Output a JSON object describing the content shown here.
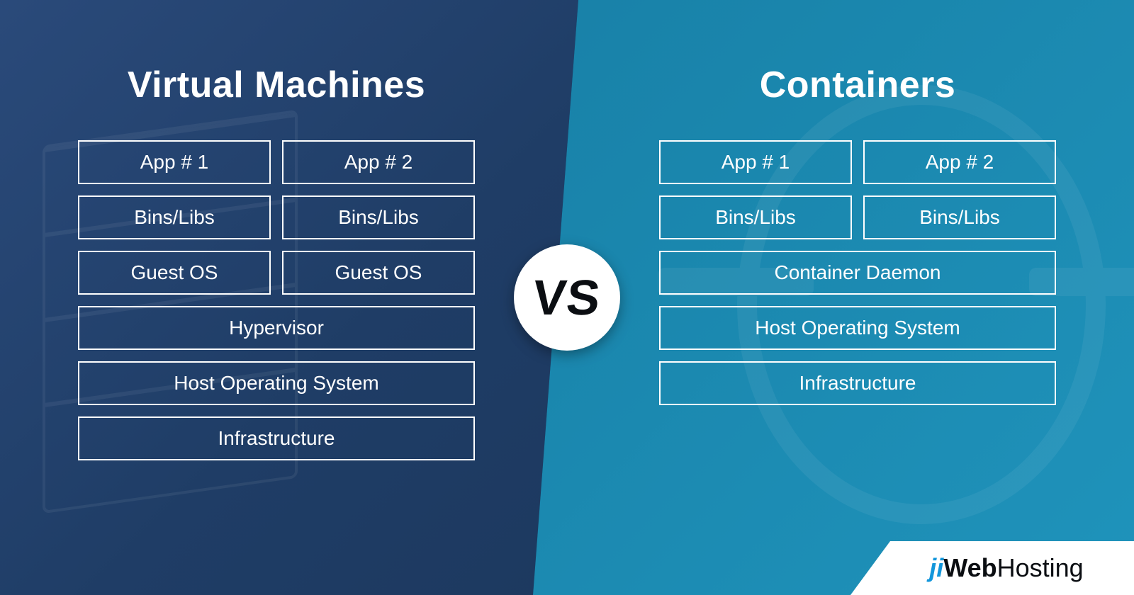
{
  "left": {
    "title": "Virtual Machines",
    "pairs": [
      [
        "App # 1",
        "App # 2"
      ],
      [
        "Bins/Libs",
        "Bins/Libs"
      ],
      [
        "Guest OS",
        "Guest OS"
      ]
    ],
    "full": [
      "Hypervisor",
      "Host Operating System",
      "Infrastructure"
    ]
  },
  "right": {
    "title": "Containers",
    "pairs": [
      [
        "App # 1",
        "App # 2"
      ],
      [
        "Bins/Libs",
        "Bins/Libs"
      ]
    ],
    "full": [
      "Container Daemon",
      "Host Operating System",
      "Infrastructure"
    ]
  },
  "center": {
    "vs": "VS"
  },
  "brand": {
    "prefix": "ji",
    "mid": "Web",
    "suffix": "Hosting"
  }
}
